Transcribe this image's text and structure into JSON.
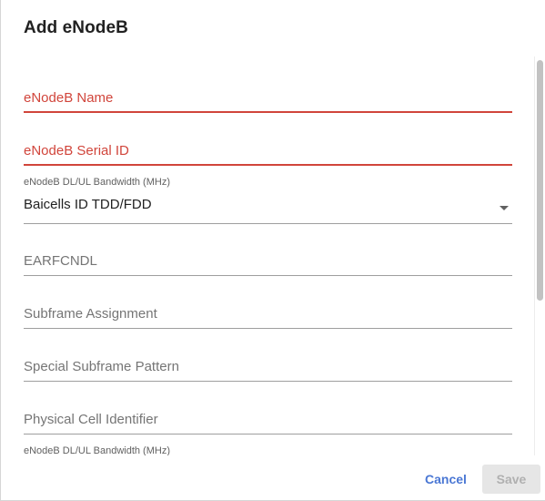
{
  "dialog": {
    "title": "Add eNodeB"
  },
  "fields": {
    "name": {
      "placeholder": "eNodeB Name"
    },
    "serial": {
      "placeholder": "eNodeB Serial ID"
    },
    "bandwidth": {
      "label": "eNodeB DL/UL Bandwidth (MHz)",
      "value": "Baicells ID TDD/FDD"
    },
    "earfcndl": {
      "placeholder": "EARFCNDL"
    },
    "subframe": {
      "placeholder": "Subframe Assignment"
    },
    "special_subframe": {
      "placeholder": "Special Subframe Pattern"
    },
    "pci": {
      "placeholder": "Physical Cell Identifier"
    },
    "bandwidth2": {
      "label": "eNodeB DL/UL Bandwidth (MHz)"
    }
  },
  "actions": {
    "cancel_label": "Cancel",
    "save_label": "Save"
  },
  "colors": {
    "error": "#d1453b",
    "primary": "#4a77d4",
    "disabled": "#b0b0b0"
  }
}
